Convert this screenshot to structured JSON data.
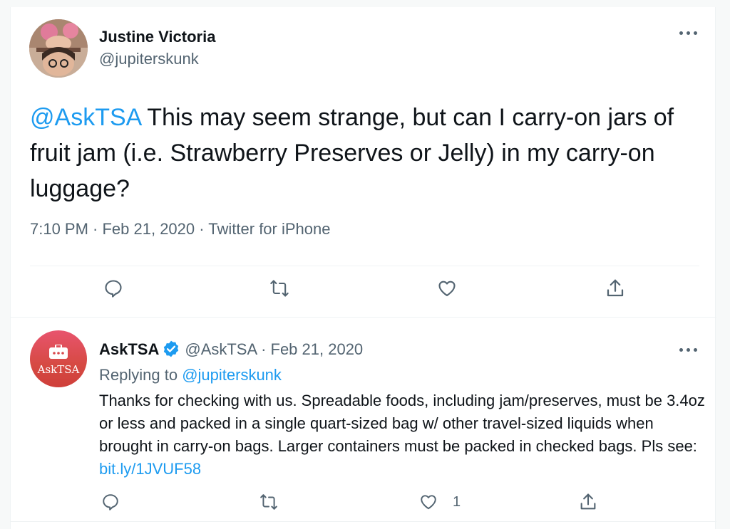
{
  "main_tweet": {
    "author_name": "Justine Victoria",
    "author_handle": "@jupiterskunk",
    "mention": "@AskTSA",
    "text": " This may seem strange, but can I carry-on jars of fruit jam (i.e. Strawberry Preserves or Jelly) in my carry-on luggage?",
    "meta": "7:10 PM · Feb 21, 2020 · Twitter for iPhone"
  },
  "reply_tweet": {
    "author_name": "AskTSA",
    "author_handle": "@AskTSA",
    "date": " · Feb 21, 2020",
    "avatar_text": "AskTSA",
    "replying_prefix": "Replying to ",
    "replying_handle": "@jupiterskunk",
    "text": "Thanks for checking with us. Spreadable foods, including jam/preserves, must be 3.4oz or less and packed in a single quart-sized bag w/ other travel-sized liquids when brought in carry-on bags. Larger containers must be packed in checked bags. Pls see: ",
    "link": "bit.ly/1JVUF58",
    "like_count": "1"
  },
  "icons": [
    "more-icon",
    "reply-icon",
    "retweet-icon",
    "like-icon",
    "share-icon",
    "verified-icon"
  ],
  "colors": {
    "accent": "#1d9bf0",
    "secondary_text": "#536471",
    "primary_text": "#0f1419"
  }
}
